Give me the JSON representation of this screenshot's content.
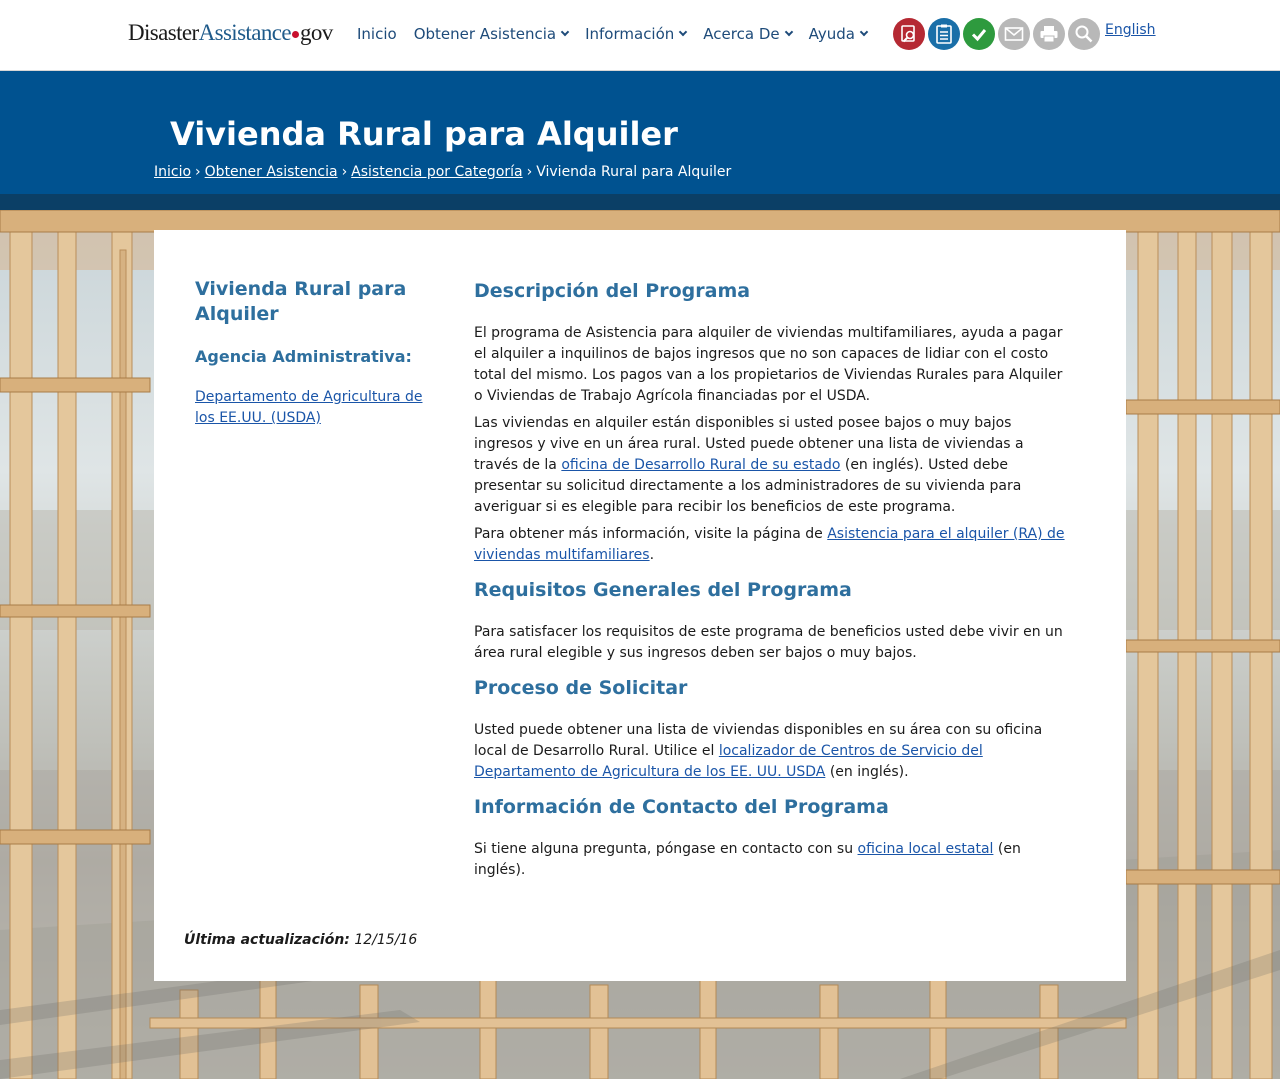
{
  "logo": {
    "part1": "Disaster",
    "part2": "Assistance",
    "part3": "gov"
  },
  "nav": {
    "inicio": "Inicio",
    "obtener": "Obtener Asistencia",
    "informacion": "Información",
    "acerca": "Acerca De",
    "ayuda": "Ayuda"
  },
  "toolbar": {
    "icons": [
      {
        "name": "search-document-icon",
        "color": "#b52933"
      },
      {
        "name": "checklist-icon",
        "color": "#1a6fa8"
      },
      {
        "name": "checkmark-icon",
        "color": "#2e9a3e"
      },
      {
        "name": "email-icon",
        "color": "#b8b8b8"
      },
      {
        "name": "print-icon",
        "color": "#b8b8b8"
      },
      {
        "name": "magnifier-icon",
        "color": "#b8b8b8"
      }
    ],
    "language": "English"
  },
  "hero": {
    "title": "Vivienda Rural para Alquiler",
    "breadcrumb": {
      "c1": "Inicio",
      "c2": "Obtener Asistencia",
      "c3": "Asistencia por Categoría",
      "current": "Vivienda Rural para Alquiler",
      "sep": "›"
    }
  },
  "sidebar": {
    "title": "Vivienda Rural para Alquiler",
    "agency_label": "Agencia Administrativa:",
    "agency_link": "Departamento de Agricultura de los EE.UU. (USDA)"
  },
  "main": {
    "s1_title": "Descripción del Programa",
    "s1_p1": "El programa de Asistencia para alquiler de viviendas multifamiliares, ayuda a pagar el alquiler a inquilinos de bajos ingresos que no son capaces de lidiar con el costo total del mismo. Los pagos van a los propietarios de Viviendas Rurales para Alquiler o Viviendas de Trabajo Agrícola financiadas por el USDA.",
    "s1_p2_a": "Las viviendas en alquiler están disponibles si usted posee bajos o muy bajos ingresos y vive en un área rural. Usted puede obtener una lista de viviendas a través de la ",
    "s1_p2_link": "oficina de Desarrollo Rural de su estado",
    "s1_p2_b": " (en inglés). Usted debe presentar su solicitud directamente a los administradores de su vivienda para averiguar si es elegible para recibir los beneficios de este programa.",
    "s1_p3_a": "Para obtener más información, visite la página de ",
    "s1_p3_link": "Asistencia para el alquiler (RA) de viviendas multifamiliares",
    "s1_p3_b": ".",
    "s2_title": "Requisitos Generales del Programa",
    "s2_p1": "Para satisfacer los requisitos de este programa de beneficios usted debe vivir en un área rural elegible y sus ingresos deben ser bajos o muy bajos.",
    "s3_title": "Proceso de Solicitar",
    "s3_p1_a": "Usted puede obtener una lista de viviendas disponibles en su área con su oficina local de Desarrollo Rural. Utilice el ",
    "s3_p1_link": "localizador de Centros de Servicio del Departamento de Agricultura de los EE. UU. USDA",
    "s3_p1_b": " (en inglés).",
    "s4_title": "Información de Contacto del Programa",
    "s4_p1_a": "Si tiene alguna pregunta, póngase en contacto con su ",
    "s4_p1_link": "oficina local estatal",
    "s4_p1_b": " (en inglés)."
  },
  "footer": {
    "updated_label": "Última actualización:",
    "updated_date": "12/15/16"
  }
}
